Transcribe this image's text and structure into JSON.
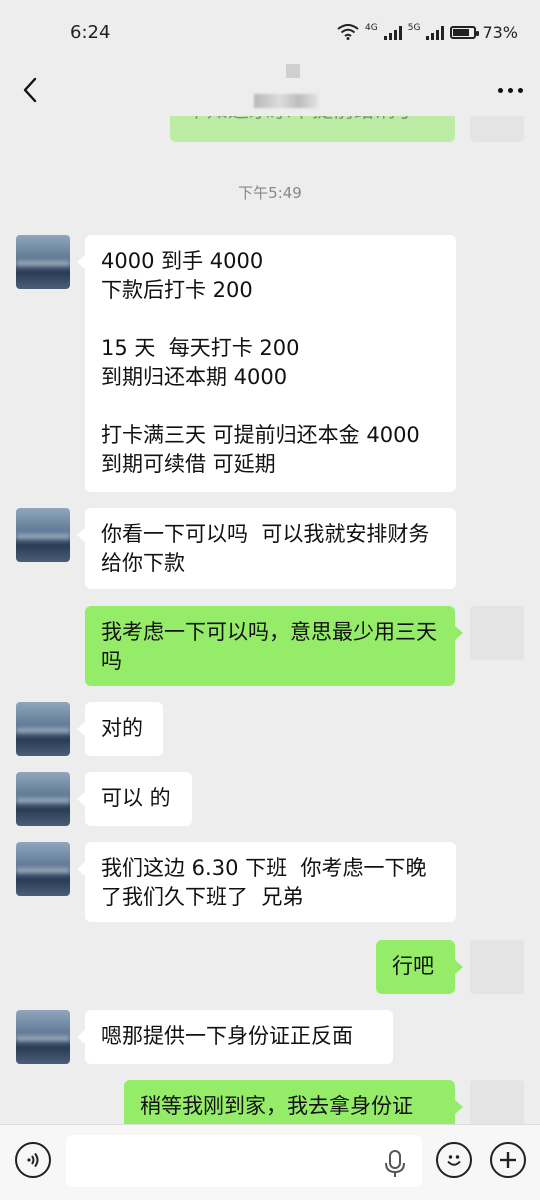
{
  "status": {
    "time": "6:24",
    "network1": "4G",
    "network2": "5G",
    "battery": "73%",
    "battery_level": 0.73
  },
  "header": {
    "back_icon": "chevron-left-icon",
    "more_icon": "more-dots-icon"
  },
  "chat": {
    "partial_top": "早知道乐乐不提前给消了",
    "timestamp": "下午5:49",
    "messages": [
      {
        "side": "in",
        "text": "4000 到手 4000\n下款后打卡 200\n\n15 天  每天打卡 200\n到期归还本期 4000\n\n打卡满三天 可提前归还本金 4000\n到期可续借 可延期"
      },
      {
        "side": "in",
        "text": "你看一下可以吗  可以我就安排财务给你下款"
      },
      {
        "side": "out",
        "text": "我考虑一下可以吗，意思最少用三天吗"
      },
      {
        "side": "in",
        "text": "对的"
      },
      {
        "side": "in",
        "text": "可以 的"
      },
      {
        "side": "in",
        "text": "我们这边 6.30 下班  你考虑一下晚了我们久下班了  兄弟"
      },
      {
        "side": "out",
        "text": "行吧"
      },
      {
        "side": "in",
        "text": "嗯那提供一下身份证正反面"
      },
      {
        "side": "out",
        "text": "稍等我刚到家，我去拿身份证"
      }
    ]
  },
  "footer": {
    "input_placeholder": "",
    "voice_icon": "voice-icon",
    "mic_icon": "mic-icon",
    "emoji_icon": "emoji-icon",
    "plus_icon": "plus-icon"
  }
}
